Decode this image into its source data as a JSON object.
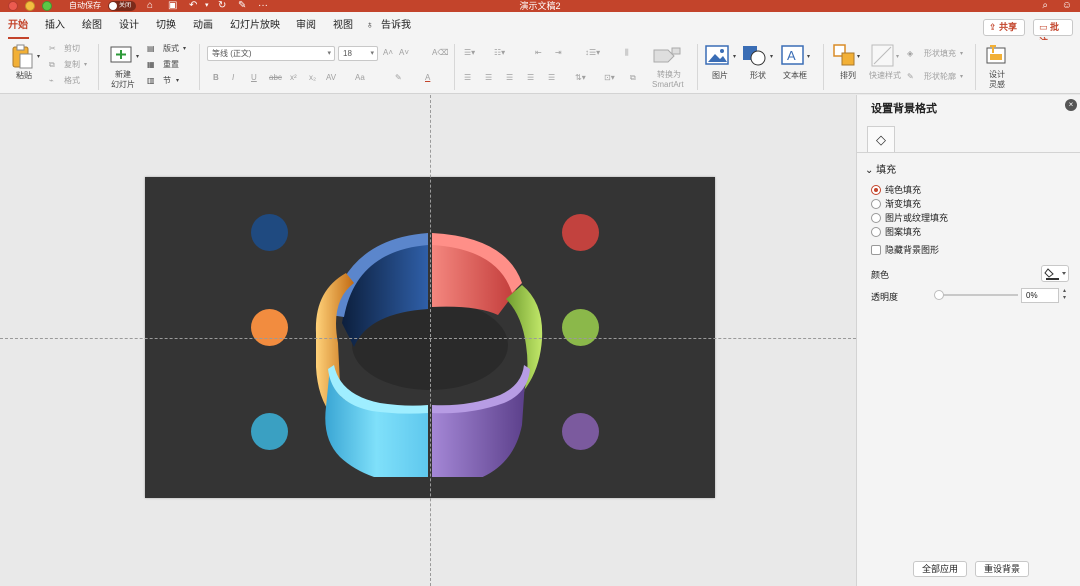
{
  "titlebar": {
    "autosave": "自动保存",
    "toggle": "关闭",
    "doc_title": "演示文稿2",
    "more": "···"
  },
  "tabs": [
    "开始",
    "插入",
    "绘图",
    "设计",
    "切换",
    "动画",
    "幻灯片放映",
    "审阅",
    "视图",
    "告诉我"
  ],
  "actions": {
    "share": "共享",
    "comment": "批注"
  },
  "ribbon": {
    "paste": "粘贴",
    "cut": "剪切",
    "copy": "复制",
    "format": "格式",
    "new_slide_1": "新建",
    "new_slide_2": "幻灯片",
    "layout": "版式",
    "reset": "重置",
    "section": "节",
    "font_name": "等线 (正文)",
    "font_size": "18",
    "bold": "B",
    "italic": "I",
    "underline": "U",
    "strike": "abc",
    "sup": "x²",
    "sub": "x₂",
    "aa": "Aa",
    "smartart_1": "转换为",
    "smartart_2": "SmartArt",
    "picture": "图片",
    "shape": "形状",
    "textbox": "文本框",
    "arrange": "排列",
    "quick_styles": "快速样式",
    "shape_fill": "形状填充",
    "shape_outline": "形状轮廓",
    "design_1": "设计",
    "design_2": "灵感"
  },
  "pane": {
    "title": "设置背景格式",
    "section": "填充",
    "options": [
      "纯色填充",
      "渐变填充",
      "图片或纹理填充",
      "图案填充"
    ],
    "selected_option": "纯色填充",
    "hide_bg": "隐藏背景图形",
    "color_label": "颜色",
    "transparency_label": "透明度",
    "transparency": "0%",
    "transparency_level": 0,
    "apply_all": "全部应用",
    "reset_bg": "重设背景"
  },
  "slide": {
    "background": "#343434",
    "dots": [
      "#1f4a80",
      "#f28c3f",
      "#3aa0c2",
      "#c2423e",
      "#8bb84a",
      "#7b5a9e"
    ],
    "ring_segments": [
      {
        "color": "#2f5fa8"
      },
      {
        "color": "#ee6f6a"
      },
      {
        "color": "#9fcf52"
      },
      {
        "color": "#9876cc"
      },
      {
        "color": "#5fc8ee"
      },
      {
        "color": "#f4a540"
      }
    ]
  },
  "colors": {
    "accent": "#c3442b"
  }
}
